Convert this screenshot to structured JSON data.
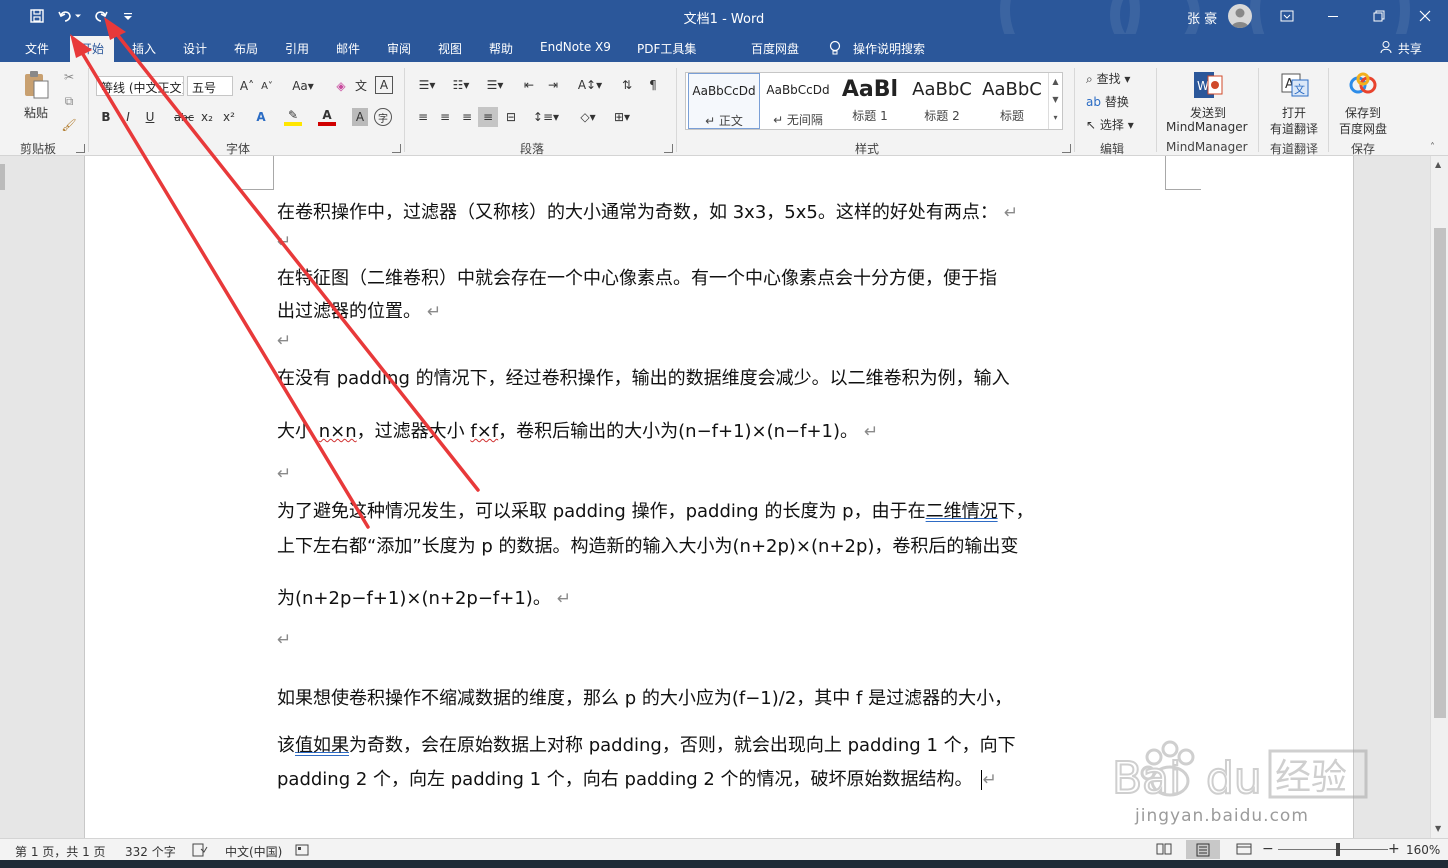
{
  "titlebar": {
    "doc_title": "文档1  -  Word",
    "user_name": "张 豪"
  },
  "tabs": [
    {
      "label": "文件"
    },
    {
      "label": "开始"
    },
    {
      "label": "插入"
    },
    {
      "label": "设计"
    },
    {
      "label": "布局"
    },
    {
      "label": "引用"
    },
    {
      "label": "邮件"
    },
    {
      "label": "审阅"
    },
    {
      "label": "视图"
    },
    {
      "label": "帮助"
    },
    {
      "label": "EndNote X9"
    },
    {
      "label": "PDF工具集"
    },
    {
      "label": "百度网盘"
    },
    {
      "label": "操作说明搜索"
    }
  ],
  "share_label": "共享",
  "ribbon": {
    "clipboard": {
      "paste_label": "粘贴",
      "group_label": "剪贴板"
    },
    "font": {
      "font_name": "等线 (中文正文)",
      "font_size": "五号",
      "group_label": "字体",
      "bold": "B",
      "italic": "I",
      "underline": "U",
      "strike": "abc",
      "subscript": "x₂",
      "superscript": "x²",
      "grow": "A",
      "shrink": "A",
      "case": "Aa",
      "phonetic": "文",
      "char_border": "A",
      "char_shade": "A",
      "enclose": "字"
    },
    "paragraph": {
      "group_label": "段落"
    },
    "styles": {
      "group_label": "样式",
      "items": [
        {
          "preview": "AaBbCcDd",
          "name": "↵ 正文"
        },
        {
          "preview": "AaBbCcDd",
          "name": "↵ 无间隔"
        },
        {
          "preview": "AaBl",
          "name": "标题 1"
        },
        {
          "preview": "AaBbC",
          "name": "标题 2"
        },
        {
          "preview": "AaBbC",
          "name": "标题"
        }
      ]
    },
    "editing": {
      "find": "查找",
      "replace": "替换",
      "select": "选择",
      "group_label": "编辑"
    },
    "mindmanager": {
      "line1": "发送到",
      "line2": "MindManager",
      "group_label": "MindManager"
    },
    "youdao": {
      "line1": "打开",
      "line2": "有道翻译",
      "group_label": "有道翻译"
    },
    "baidu": {
      "line1": "保存到",
      "line2": "百度网盘",
      "group_label": "保存"
    }
  },
  "document": {
    "p1": "在卷积操作中，过滤器（又称核）的大小通常为奇数，如 3x3，5x5。这样的好处有两点：",
    "p2a": "在特征图（二维卷积）中就会存在一个中心像素点。有一个中心像素点会十分方便，便于指",
    "p2b": "出过滤器的位置。",
    "p3a": "在没有 padding 的情况下，经过卷积操作，输出的数据维度会减少。以二维卷积为例，输入",
    "p3b_1": "大小 ",
    "p3b_2": "n×n",
    "p3b_3": "，过滤器大小 ",
    "p3b_4": "f×f",
    "p3b_5": "，卷积后输出的大小为(n−f+1)×(n−f+1)。",
    "p4a_1": "为了避免这种情况发生，可以采取 padding 操作，padding 的长度为 p，由于在",
    "p4a_2": "二维情况",
    "p4a_3": "下，",
    "p4b": "上下左右都“添加”长度为 p 的数据。构造新的输入大小为(n+2p)×(n+2p)，卷积后的输出变",
    "p4c": "为(n+2p−f+1)×(n+2p−f+1)。",
    "p5a": "如果想使卷积操作不缩减数据的维度，那么 p 的大小应为(f−1)/2，其中 f 是过滤器的大小，",
    "p5b_1": "该",
    "p5b_2": "值如果",
    "p5b_3": "为奇数，会在原始数据上对称 padding，否则，就会出现向上 padding 1 个，向下",
    "p5c": "padding 2 个，向左 padding 1 个，向右 padding 2 个的情况，破坏原始数据结构。",
    "para_mark": "↵"
  },
  "statusbar": {
    "page": "第 1 页，共 1 页",
    "words": "332 个字",
    "lang": "中文(中国)",
    "zoom": "160%"
  },
  "watermark": {
    "text": "jingyan.baidu.com"
  }
}
